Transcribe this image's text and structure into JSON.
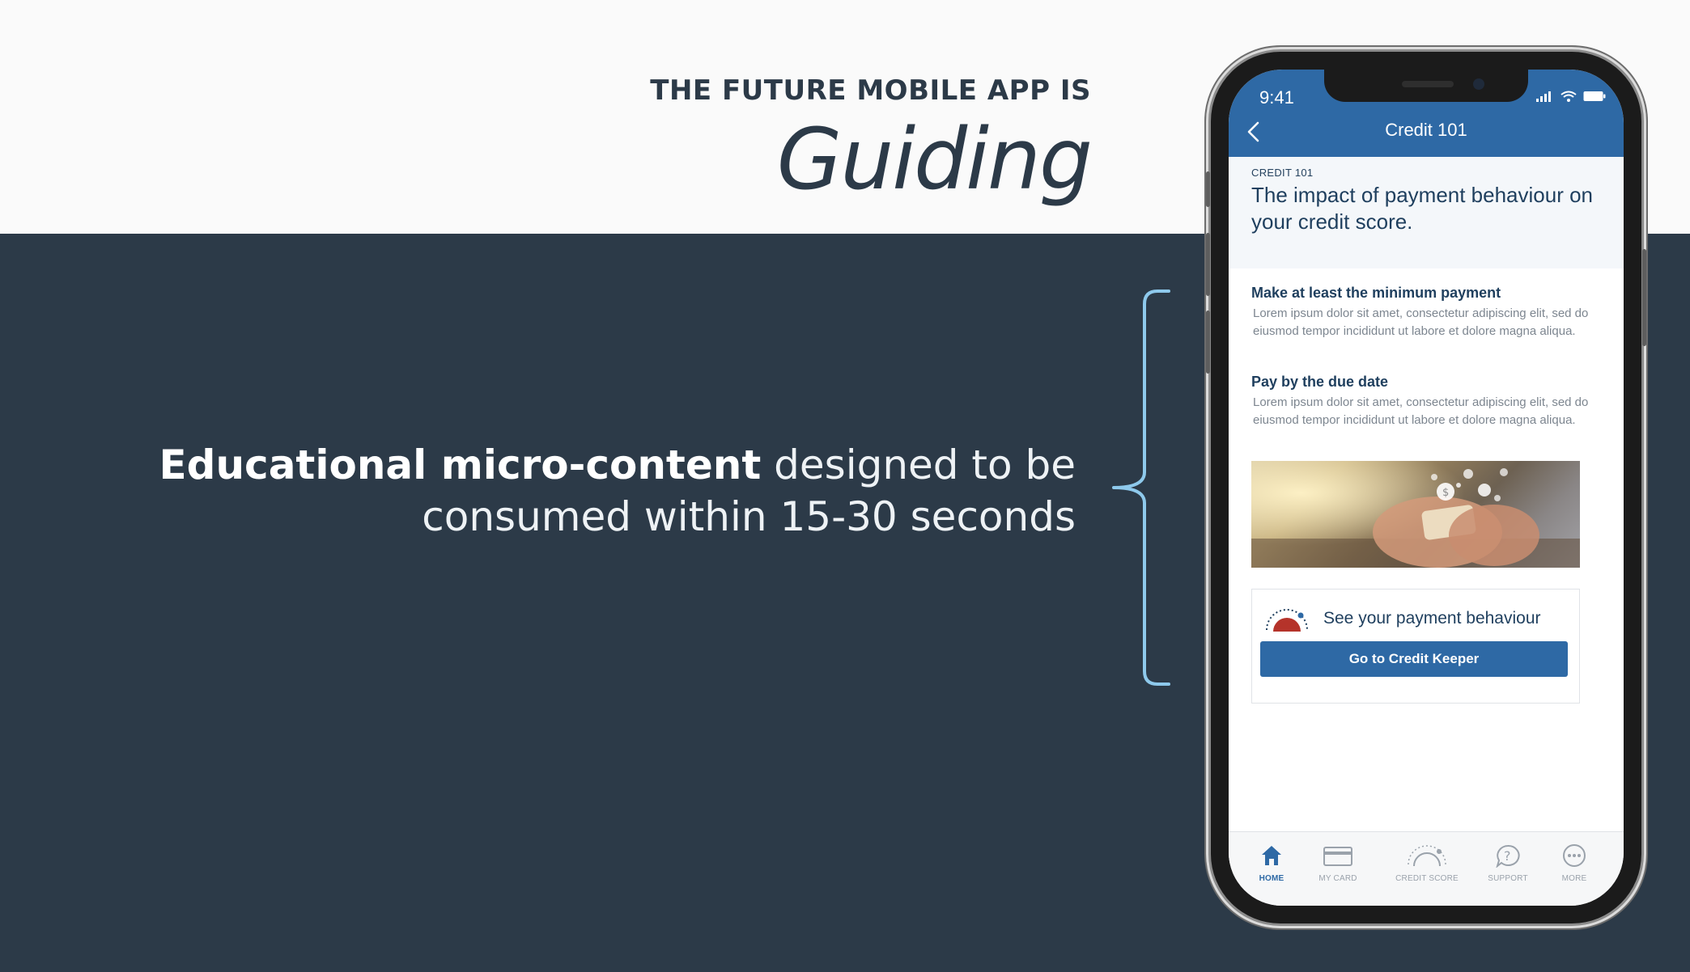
{
  "hero": {
    "eyebrow": "THE FUTURE MOBILE APP IS",
    "headline_word": "Guiding"
  },
  "tagline": {
    "bold": "Educational micro-content",
    "light_1": " designed to be",
    "line2": "consumed within 15-30 seconds"
  },
  "phone": {
    "status_time": "9:41",
    "nav_title": "Credit 101",
    "intro": {
      "kicker": "CREDIT 101",
      "title": "The impact of payment behaviour on your credit score."
    },
    "sections": [
      {
        "heading": "Make at least the minimum payment",
        "body": "Lorem ipsum dolor sit amet, consectetur adipiscing elit, sed do eiusmod tempor incididunt ut labore et dolore magna aliqua."
      },
      {
        "heading": "Pay by the due date",
        "body": "Lorem ipsum dolor sit amet, consectetur adipiscing elit, sed do eiusmod tempor incididunt ut labore et dolore magna aliqua."
      }
    ],
    "card": {
      "text": "See your payment behaviour",
      "button": "Go to Credit Keeper"
    },
    "tabs": [
      {
        "label": "HOME",
        "icon": "home-icon",
        "active": true
      },
      {
        "label": "MY CARD",
        "icon": "credit-card-icon"
      },
      {
        "label": "CREDIT SCORE",
        "icon": "gauge-icon"
      },
      {
        "label": "SUPPORT",
        "icon": "help-bubble-icon"
      },
      {
        "label": "MORE",
        "icon": "more-dots-icon"
      }
    ],
    "colors": {
      "brand_blue": "#2e69a5",
      "navy_text": "#1f3f5e",
      "gauge_red": "#b5332a"
    }
  },
  "colors": {
    "dark_band": "#2c3a48",
    "bracket": "#8ec9ec"
  }
}
